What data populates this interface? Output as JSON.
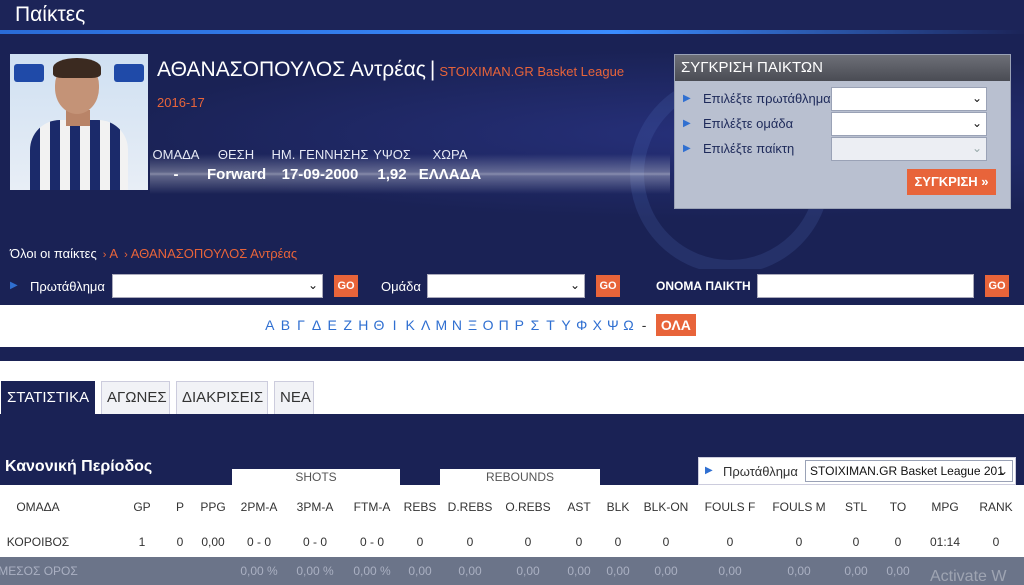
{
  "page": {
    "title": "Παίκτες"
  },
  "player": {
    "name": "ΑΘΑΝΑΣΟΠΟΥΛΟΣ Αντρέας",
    "separator": "|",
    "league": "STOIXIMAN.GR Basket League",
    "season": "2016-17",
    "info": [
      {
        "label": "ΟΜΑΔΑ",
        "value": "-"
      },
      {
        "label": "ΘΕΣΗ",
        "value": "Forward"
      },
      {
        "label": "ΗΜ. ΓΕΝΝΗΣΗΣ",
        "value": "17-09-2000"
      },
      {
        "label": "ΥΨΟΣ",
        "value": "1,92"
      },
      {
        "label": "ΧΩΡΑ",
        "value": "ΕΛΛΑΔΑ"
      }
    ]
  },
  "compare": {
    "title": "ΣΥΓΚΡΙΣΗ ΠΑΙΚΤΩΝ",
    "rows": [
      {
        "label": "Επιλέξτε πρωτάθλημα"
      },
      {
        "label": "Επιλέξτε ομάδα"
      },
      {
        "label": "Επιλέξτε παίκτη"
      }
    ],
    "button": "ΣΥΓΚΡΙΣΗ »"
  },
  "breadcrumb": {
    "root": "Όλοι οι παίκτες",
    "sep": "›",
    "letter": "Α",
    "current": "ΑΘΑΝΑΣΟΠΟΥΛΟΣ Αντρέας"
  },
  "filters": {
    "championship_label": "Πρωτάθλημα",
    "team_label": "Ομάδα",
    "player_name_label": "ΟΝΟΜΑ ΠΑΙΚΤΗ",
    "go": "GO"
  },
  "alphabet": {
    "letters": [
      "Α",
      "Β",
      "Γ",
      "Δ",
      "Ε",
      "Ζ",
      "Η",
      "Θ",
      "Ι",
      "Κ",
      "Λ",
      "Μ",
      "Ν",
      "Ξ",
      "Ο",
      "Π",
      "Ρ",
      "Σ",
      "Τ",
      "Υ",
      "Φ",
      "Χ",
      "Ψ",
      "Ω"
    ],
    "dash": "-",
    "all": "ΟΛΑ"
  },
  "tabs": [
    "ΣΤΑΤΙΣΤΙΚΑ",
    "ΑΓΩΝΕΣ",
    "ΔΙΑΚΡΙΣΕΙΣ",
    "ΝΕΑ"
  ],
  "stats": {
    "section_title": "Κανονική Περίοδος",
    "groups": {
      "shots": "SHOTS",
      "rebounds": "REBOUNDS"
    },
    "championship_label": "Πρωτάθλημα",
    "championship_value": "STOIXIMAN.GR Basket League 201",
    "columns": [
      "ΟΜΑΔΑ",
      "GP",
      "P",
      "PPG",
      "2PM-A",
      "3PM-A",
      "FTM-A",
      "REBS",
      "D.REBS",
      "O.REBS",
      "AST",
      "BLK",
      "BLK-ON",
      "FOULS F",
      "FOULS M",
      "STL",
      "TO",
      "MPG",
      "RANK"
    ],
    "row": [
      "ΚΟΡΟΙΒΟΣ",
      "1",
      "0",
      "0,00",
      "0 - 0",
      "0 - 0",
      "0 - 0",
      "0",
      "0",
      "0",
      "0",
      "0",
      "0",
      "0",
      "0",
      "0",
      "0",
      "01:14",
      "0"
    ],
    "avg": [
      "ΜΕΣΟΣ ΟΡΟΣ",
      "",
      "",
      "",
      "0,00 %",
      "0,00 %",
      "0,00 %",
      "0,00",
      "0,00",
      "0,00",
      "0,00",
      "0,00",
      "0,00",
      "0,00",
      "0,00",
      "0,00",
      "0,00",
      "",
      ""
    ]
  },
  "watermark": "Activate W"
}
